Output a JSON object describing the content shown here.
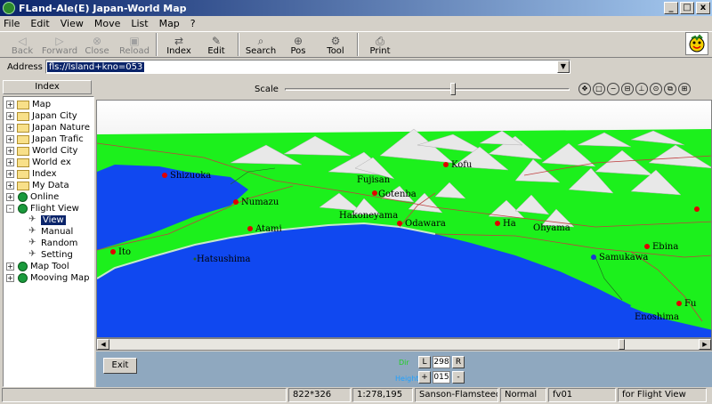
{
  "window": {
    "title": "FLand-Ale(E) Japan-World Map",
    "buttons": [
      "_",
      "□",
      "x"
    ]
  },
  "menu": [
    "File",
    "Edit",
    "View",
    "Move",
    "List",
    "Map",
    "?"
  ],
  "toolbar": {
    "back": "Back",
    "forward": "Forward",
    "close": "Close",
    "reload": "Reload",
    "index": "Index",
    "edit": "Edit",
    "search": "Search",
    "pos": "Pos",
    "tool": "Tool",
    "print": "Print"
  },
  "address": {
    "label": "Address",
    "value": "fls://Island+kno=053"
  },
  "sidebar": {
    "header": "Index",
    "items": [
      {
        "label": "Map",
        "type": "folder",
        "expand": "+"
      },
      {
        "label": "Japan City",
        "type": "folder",
        "expand": "+"
      },
      {
        "label": "Japan Nature",
        "type": "folder",
        "expand": "+"
      },
      {
        "label": "Japan Trafic",
        "type": "folder",
        "expand": "+"
      },
      {
        "label": "World City",
        "type": "folder",
        "expand": "+"
      },
      {
        "label": "World ex",
        "type": "folder",
        "expand": "+"
      },
      {
        "label": "Index",
        "type": "folder",
        "expand": "+"
      },
      {
        "label": "My Data",
        "type": "folder",
        "expand": "+"
      },
      {
        "label": "Online",
        "type": "globe",
        "expand": "+"
      },
      {
        "label": "Flight View",
        "type": "globe",
        "expand": "-"
      },
      {
        "label": "View",
        "type": "child",
        "selected": true
      },
      {
        "label": "Manual",
        "type": "child"
      },
      {
        "label": "Random",
        "type": "child"
      },
      {
        "label": "Setting",
        "type": "child"
      },
      {
        "label": "Map Tool",
        "type": "globe",
        "expand": "+"
      },
      {
        "label": "Mooving Map",
        "type": "globe",
        "expand": "+"
      }
    ]
  },
  "scale": {
    "label": "Scale",
    "level": 0.59
  },
  "map_labels": {
    "numazu": "Numazu",
    "shizuoka": "Shizuoka",
    "kofu": "Kofu",
    "fujisan": "Fujisan",
    "gotenba": "Gotenba",
    "hakoneyama": "Hakoneyama",
    "odawara": "Odawara",
    "atami": "Atami",
    "ito": "Ito",
    "hatsushima": "Hatsushima",
    "hadano": "Ha",
    "oyama": "Ohyama",
    "ebina": "Ebina",
    "samukawa": "Samukawa",
    "enoshima": "Enoshima",
    "fujisawa": "Fu"
  },
  "controls": {
    "exit": "Exit",
    "dir_label": "Dir",
    "height_label": "Height",
    "left": "L",
    "right": "R",
    "plus": "+",
    "minus": "-",
    "dir_value": "298",
    "height_value": "015"
  },
  "status": {
    "size": "822*326",
    "scale": "1:278,195",
    "projection": "Sanson-Flamsteed's",
    "mode": "Normal",
    "view": "fv01",
    "hint": "for Flight View"
  },
  "colors": {
    "land": "#1cf01c",
    "sea": "#1040f0",
    "mountain": "#e8e8e8",
    "city_dot": "#e00000",
    "title_start": "#0a246a"
  }
}
